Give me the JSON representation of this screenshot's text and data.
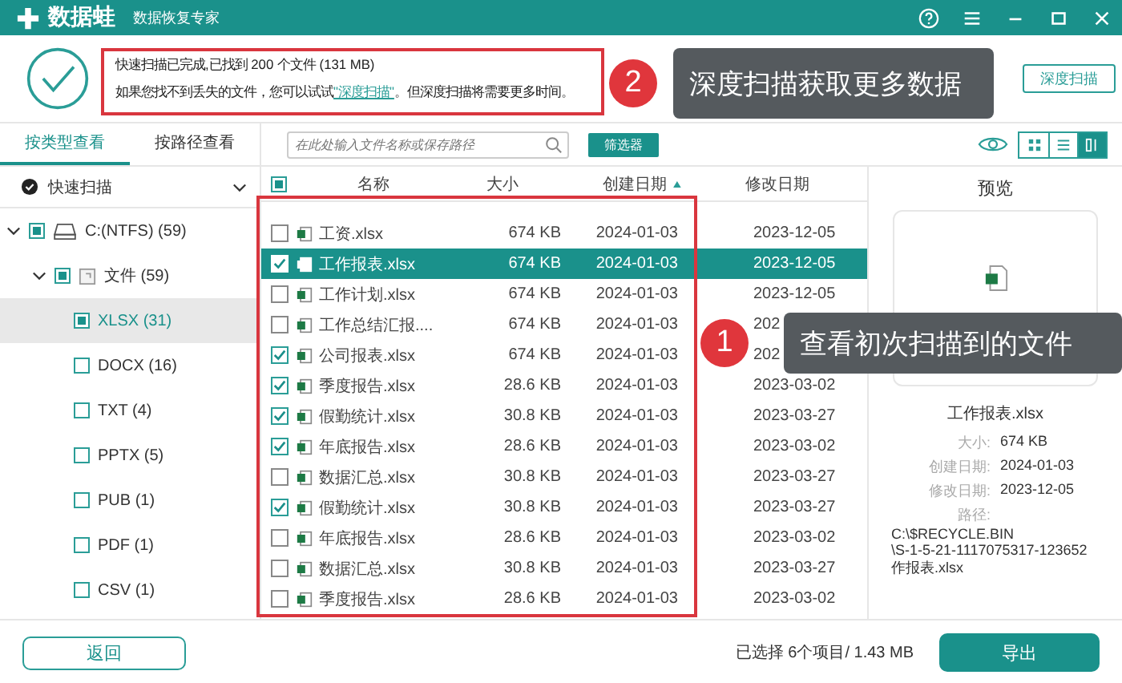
{
  "window": {
    "app_name": "数据蛙",
    "subtitle": "数据恢复专家"
  },
  "scan_summary": {
    "line_1": "快速扫描已完成,已找到 200 个文件 (131 MB)",
    "line_2_before": "如果您找不到丢失的文件，您可以试试",
    "line_2_link": "\"深度扫描\"",
    "line_2_after": "。但深度扫描将需要更多时间。",
    "deep_scan_button": "深度扫描"
  },
  "view_tabs": [
    {
      "label": "按类型查看",
      "selected": true
    },
    {
      "label": "按路径查看",
      "selected": false
    }
  ],
  "search": {
    "placeholder": "在此处输入文件名称或保存路径"
  },
  "filter_button": "筛选器",
  "view_modes": [
    {
      "kind": "grid",
      "selected": false
    },
    {
      "kind": "list",
      "selected": false
    },
    {
      "kind": "detail",
      "selected": true
    }
  ],
  "scan_mode": {
    "label": "快速扫描"
  },
  "tree": [
    {
      "label": "C:(NTFS) (59)",
      "kind": "drive",
      "checked": true,
      "expanded": true,
      "selected": false,
      "children": [
        {
          "label": "文件 (59)",
          "kind": "folder",
          "checked": true,
          "expanded": true,
          "selected": false,
          "children": [
            {
              "label": "XLSX (31)",
              "checked": true,
              "selected": true
            },
            {
              "label": "DOCX (16)",
              "checked": false,
              "selected": false
            },
            {
              "label": "TXT (4)",
              "checked": false,
              "selected": false
            },
            {
              "label": "PPTX (5)",
              "checked": false,
              "selected": false
            },
            {
              "label": "PUB (1)",
              "checked": false,
              "selected": false
            },
            {
              "label": "PDF (1)",
              "checked": false,
              "selected": false
            },
            {
              "label": "CSV (1)",
              "checked": false,
              "selected": false
            }
          ]
        }
      ]
    }
  ],
  "table": {
    "select_all": {
      "checked": true
    },
    "columns": [
      "名称",
      "大小",
      "创建日期",
      "修改日期"
    ],
    "rows": [
      {
        "name": "工资.xlsx",
        "size": "674 KB",
        "created": "2024-01-03",
        "modified": "2023-12-05",
        "checked": false,
        "selected": false
      },
      {
        "name": "工作报表.xlsx",
        "size": "674 KB",
        "created": "2024-01-03",
        "modified": "2023-12-05",
        "checked": true,
        "selected": true
      },
      {
        "name": "工作计划.xlsx",
        "size": "674 KB",
        "created": "2024-01-03",
        "modified": "2023-12-05",
        "checked": false,
        "selected": false
      },
      {
        "name": "工作总结汇报....",
        "size": "674 KB",
        "created": "2024-01-03",
        "modified": "202",
        "checked": false,
        "selected": false
      },
      {
        "name": "公司报表.xlsx",
        "size": "674 KB",
        "created": "2024-01-03",
        "modified": "202",
        "checked": true,
        "selected": false
      },
      {
        "name": "季度报告.xlsx",
        "size": "28.6 KB",
        "created": "2024-01-03",
        "modified": "2023-03-02",
        "checked": true,
        "selected": false
      },
      {
        "name": "假勤统计.xlsx",
        "size": "30.8 KB",
        "created": "2024-01-03",
        "modified": "2023-03-27",
        "checked": true,
        "selected": false
      },
      {
        "name": "年底报告.xlsx",
        "size": "28.6 KB",
        "created": "2024-01-03",
        "modified": "2023-03-02",
        "checked": true,
        "selected": false
      },
      {
        "name": "数据汇总.xlsx",
        "size": "30.8 KB",
        "created": "2024-01-03",
        "modified": "2023-03-27",
        "checked": false,
        "selected": false
      },
      {
        "name": "假勤统计.xlsx",
        "size": "30.8 KB",
        "created": "2024-01-03",
        "modified": "2023-03-27",
        "checked": true,
        "selected": false
      },
      {
        "name": "年底报告.xlsx",
        "size": "28.6 KB",
        "created": "2024-01-03",
        "modified": "2023-03-02",
        "checked": false,
        "selected": false
      },
      {
        "name": "数据汇总.xlsx",
        "size": "30.8 KB",
        "created": "2024-01-03",
        "modified": "2023-03-27",
        "checked": false,
        "selected": false
      },
      {
        "name": "季度报告.xlsx",
        "size": "28.6 KB",
        "created": "2024-01-03",
        "modified": "2023-03-02",
        "checked": false,
        "selected": false
      }
    ]
  },
  "preview": {
    "title": "预览",
    "file_name": "工作报表.xlsx",
    "details": [
      {
        "label": "大小:",
        "value": "674 KB"
      },
      {
        "label": "创建日期:",
        "value": "2024-01-03"
      },
      {
        "label": "修改日期:",
        "value": "2023-12-05"
      }
    ],
    "path_label": "路径:",
    "path_lines": [
      "C:\\$RECYCLE.BIN",
      "\\S-1-5-21-1117075317-123652",
      "作报表.xlsx"
    ]
  },
  "footer": {
    "back_button": "返回",
    "selection_summary": "已选择 6个项目/ 1.43 MB",
    "export_button": "导出"
  },
  "callouts": [
    {
      "number": "2",
      "text": "深度扫描获取更多数据"
    },
    {
      "number": "1",
      "text": "查看初次扫描到的文件"
    }
  ]
}
